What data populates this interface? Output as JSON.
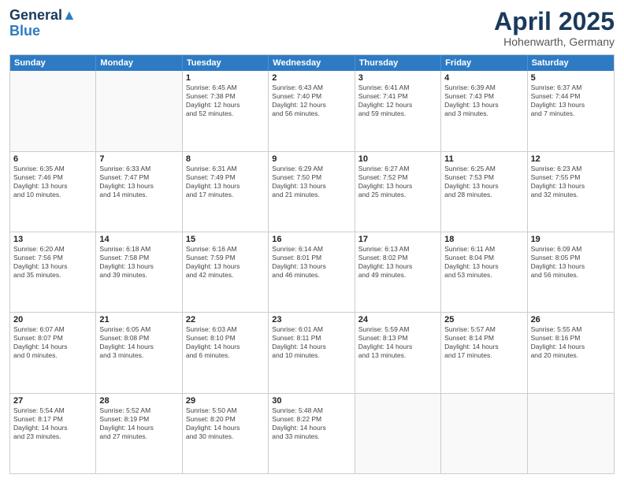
{
  "header": {
    "logo_line1": "General",
    "logo_line2": "Blue",
    "month": "April 2025",
    "location": "Hohenwarth, Germany"
  },
  "day_headers": [
    "Sunday",
    "Monday",
    "Tuesday",
    "Wednesday",
    "Thursday",
    "Friday",
    "Saturday"
  ],
  "rows": [
    [
      {
        "day": "",
        "info": ""
      },
      {
        "day": "",
        "info": ""
      },
      {
        "day": "1",
        "info": "Sunrise: 6:45 AM\nSunset: 7:38 PM\nDaylight: 12 hours\nand 52 minutes."
      },
      {
        "day": "2",
        "info": "Sunrise: 6:43 AM\nSunset: 7:40 PM\nDaylight: 12 hours\nand 56 minutes."
      },
      {
        "day": "3",
        "info": "Sunrise: 6:41 AM\nSunset: 7:41 PM\nDaylight: 12 hours\nand 59 minutes."
      },
      {
        "day": "4",
        "info": "Sunrise: 6:39 AM\nSunset: 7:43 PM\nDaylight: 13 hours\nand 3 minutes."
      },
      {
        "day": "5",
        "info": "Sunrise: 6:37 AM\nSunset: 7:44 PM\nDaylight: 13 hours\nand 7 minutes."
      }
    ],
    [
      {
        "day": "6",
        "info": "Sunrise: 6:35 AM\nSunset: 7:46 PM\nDaylight: 13 hours\nand 10 minutes."
      },
      {
        "day": "7",
        "info": "Sunrise: 6:33 AM\nSunset: 7:47 PM\nDaylight: 13 hours\nand 14 minutes."
      },
      {
        "day": "8",
        "info": "Sunrise: 6:31 AM\nSunset: 7:49 PM\nDaylight: 13 hours\nand 17 minutes."
      },
      {
        "day": "9",
        "info": "Sunrise: 6:29 AM\nSunset: 7:50 PM\nDaylight: 13 hours\nand 21 minutes."
      },
      {
        "day": "10",
        "info": "Sunrise: 6:27 AM\nSunset: 7:52 PM\nDaylight: 13 hours\nand 25 minutes."
      },
      {
        "day": "11",
        "info": "Sunrise: 6:25 AM\nSunset: 7:53 PM\nDaylight: 13 hours\nand 28 minutes."
      },
      {
        "day": "12",
        "info": "Sunrise: 6:23 AM\nSunset: 7:55 PM\nDaylight: 13 hours\nand 32 minutes."
      }
    ],
    [
      {
        "day": "13",
        "info": "Sunrise: 6:20 AM\nSunset: 7:56 PM\nDaylight: 13 hours\nand 35 minutes."
      },
      {
        "day": "14",
        "info": "Sunrise: 6:18 AM\nSunset: 7:58 PM\nDaylight: 13 hours\nand 39 minutes."
      },
      {
        "day": "15",
        "info": "Sunrise: 6:16 AM\nSunset: 7:59 PM\nDaylight: 13 hours\nand 42 minutes."
      },
      {
        "day": "16",
        "info": "Sunrise: 6:14 AM\nSunset: 8:01 PM\nDaylight: 13 hours\nand 46 minutes."
      },
      {
        "day": "17",
        "info": "Sunrise: 6:13 AM\nSunset: 8:02 PM\nDaylight: 13 hours\nand 49 minutes."
      },
      {
        "day": "18",
        "info": "Sunrise: 6:11 AM\nSunset: 8:04 PM\nDaylight: 13 hours\nand 53 minutes."
      },
      {
        "day": "19",
        "info": "Sunrise: 6:09 AM\nSunset: 8:05 PM\nDaylight: 13 hours\nand 56 minutes."
      }
    ],
    [
      {
        "day": "20",
        "info": "Sunrise: 6:07 AM\nSunset: 8:07 PM\nDaylight: 14 hours\nand 0 minutes."
      },
      {
        "day": "21",
        "info": "Sunrise: 6:05 AM\nSunset: 8:08 PM\nDaylight: 14 hours\nand 3 minutes."
      },
      {
        "day": "22",
        "info": "Sunrise: 6:03 AM\nSunset: 8:10 PM\nDaylight: 14 hours\nand 6 minutes."
      },
      {
        "day": "23",
        "info": "Sunrise: 6:01 AM\nSunset: 8:11 PM\nDaylight: 14 hours\nand 10 minutes."
      },
      {
        "day": "24",
        "info": "Sunrise: 5:59 AM\nSunset: 8:13 PM\nDaylight: 14 hours\nand 13 minutes."
      },
      {
        "day": "25",
        "info": "Sunrise: 5:57 AM\nSunset: 8:14 PM\nDaylight: 14 hours\nand 17 minutes."
      },
      {
        "day": "26",
        "info": "Sunrise: 5:55 AM\nSunset: 8:16 PM\nDaylight: 14 hours\nand 20 minutes."
      }
    ],
    [
      {
        "day": "27",
        "info": "Sunrise: 5:54 AM\nSunset: 8:17 PM\nDaylight: 14 hours\nand 23 minutes."
      },
      {
        "day": "28",
        "info": "Sunrise: 5:52 AM\nSunset: 8:19 PM\nDaylight: 14 hours\nand 27 minutes."
      },
      {
        "day": "29",
        "info": "Sunrise: 5:50 AM\nSunset: 8:20 PM\nDaylight: 14 hours\nand 30 minutes."
      },
      {
        "day": "30",
        "info": "Sunrise: 5:48 AM\nSunset: 8:22 PM\nDaylight: 14 hours\nand 33 minutes."
      },
      {
        "day": "",
        "info": ""
      },
      {
        "day": "",
        "info": ""
      },
      {
        "day": "",
        "info": ""
      }
    ]
  ]
}
